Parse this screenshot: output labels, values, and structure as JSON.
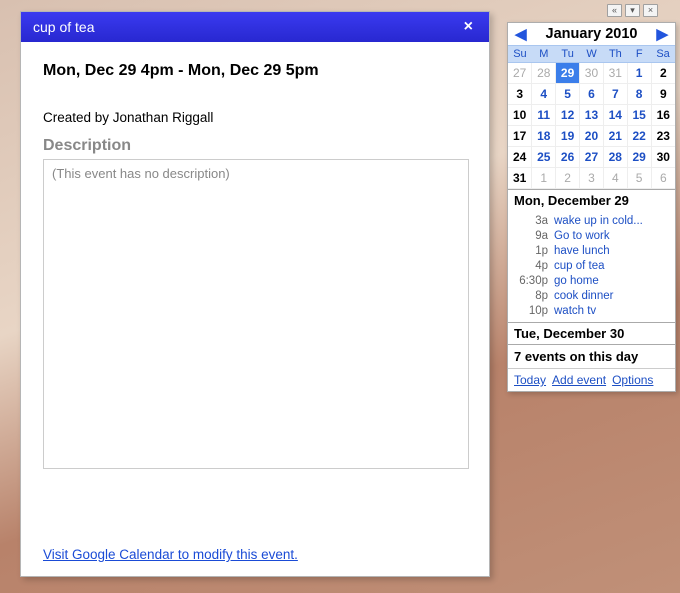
{
  "event_panel": {
    "title": "cup of tea",
    "time_line": "Mon, Dec 29 4pm - Mon, Dec 29 5pm",
    "creator_line": "Created by Jonathan Riggall",
    "description_label": "Description",
    "description_placeholder": "(This event has no description)",
    "footer_link": "Visit Google Calendar to modify this event."
  },
  "gadget_bar": {
    "prev": "«",
    "more": "▾",
    "close": "×"
  },
  "calendar": {
    "month_label": "January 2010",
    "weekdays": [
      "Su",
      "M",
      "Tu",
      "W",
      "Th",
      "F",
      "Sa"
    ],
    "rows": [
      [
        {
          "n": "27",
          "cls": "other"
        },
        {
          "n": "28",
          "cls": "other"
        },
        {
          "n": "29",
          "cls": "selected"
        },
        {
          "n": "30",
          "cls": "other"
        },
        {
          "n": "31",
          "cls": "other"
        },
        {
          "n": "1",
          "cls": "link"
        },
        {
          "n": "2",
          "cls": ""
        }
      ],
      [
        {
          "n": "3",
          "cls": ""
        },
        {
          "n": "4",
          "cls": "link"
        },
        {
          "n": "5",
          "cls": "link"
        },
        {
          "n": "6",
          "cls": "link"
        },
        {
          "n": "7",
          "cls": "link"
        },
        {
          "n": "8",
          "cls": "link"
        },
        {
          "n": "9",
          "cls": ""
        }
      ],
      [
        {
          "n": "10",
          "cls": ""
        },
        {
          "n": "11",
          "cls": "link"
        },
        {
          "n": "12",
          "cls": "link"
        },
        {
          "n": "13",
          "cls": "link"
        },
        {
          "n": "14",
          "cls": "link"
        },
        {
          "n": "15",
          "cls": "link"
        },
        {
          "n": "16",
          "cls": ""
        }
      ],
      [
        {
          "n": "17",
          "cls": ""
        },
        {
          "n": "18",
          "cls": "link"
        },
        {
          "n": "19",
          "cls": "link"
        },
        {
          "n": "20",
          "cls": "link"
        },
        {
          "n": "21",
          "cls": "link"
        },
        {
          "n": "22",
          "cls": "link"
        },
        {
          "n": "23",
          "cls": ""
        }
      ],
      [
        {
          "n": "24",
          "cls": ""
        },
        {
          "n": "25",
          "cls": "link"
        },
        {
          "n": "26",
          "cls": "link"
        },
        {
          "n": "27",
          "cls": "link"
        },
        {
          "n": "28",
          "cls": "link"
        },
        {
          "n": "29",
          "cls": "link"
        },
        {
          "n": "30",
          "cls": ""
        }
      ],
      [
        {
          "n": "31",
          "cls": ""
        },
        {
          "n": "1",
          "cls": "other"
        },
        {
          "n": "2",
          "cls": "other"
        },
        {
          "n": "3",
          "cls": "other"
        },
        {
          "n": "4",
          "cls": "other"
        },
        {
          "n": "5",
          "cls": "other"
        },
        {
          "n": "6",
          "cls": "other"
        }
      ]
    ],
    "day1_header": "Mon, December 29",
    "day1_events": [
      {
        "time": "3a",
        "title": "wake up in cold..."
      },
      {
        "time": "9a",
        "title": "Go to work"
      },
      {
        "time": "1p",
        "title": "have lunch"
      },
      {
        "time": "4p",
        "title": "cup of tea"
      },
      {
        "time": "6:30p",
        "title": "go home"
      },
      {
        "time": "8p",
        "title": "cook dinner"
      },
      {
        "time": "10p",
        "title": "watch tv"
      }
    ],
    "day2_header": "Tue, December 30",
    "day2_summary": "7 events on this day",
    "footer": {
      "today": "Today",
      "add": "Add event",
      "options": "Options"
    }
  }
}
